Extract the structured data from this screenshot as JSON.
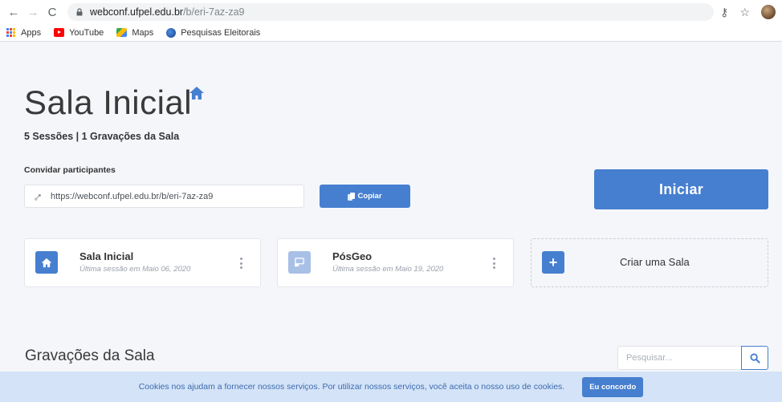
{
  "browser": {
    "url_host": "webconf.ufpel.edu.br",
    "url_path": "/b/eri-7az-za9",
    "bookmarks": [
      "Apps",
      "YouTube",
      "Maps",
      "Pesquisas Eleitorais"
    ]
  },
  "room": {
    "title": "Sala Inicial",
    "stats": "5 Sessões | 1 Gravações da Sala",
    "invite_label": "Convidar participantes",
    "invite_link": "https://webconf.ufpel.edu.br/b/eri-7az-za9",
    "copy_label": "Copiar",
    "start_label": "Iniciar"
  },
  "rooms": [
    {
      "name": "Sala Inicial",
      "last_session": "Última sessão em Maio 06, 2020"
    },
    {
      "name": "PósGeo",
      "last_session": "Última sessão em Maio 19, 2020"
    }
  ],
  "create_room_label": "Criar uma Sala",
  "recordings": {
    "title": "Gravações da Sala",
    "search_placeholder": "Pesquisar..."
  },
  "cookie": {
    "text": "Cookies nos ajudam a fornecer nossos serviços. Por utilizar nossos serviços, você aceita o nosso uso de cookies.",
    "accept_label": "Eu concordo"
  },
  "colors": {
    "primary": "#467fcf",
    "room_badge_muted": "#a9c0e6",
    "cookie_bg": "#d4e3f7"
  }
}
